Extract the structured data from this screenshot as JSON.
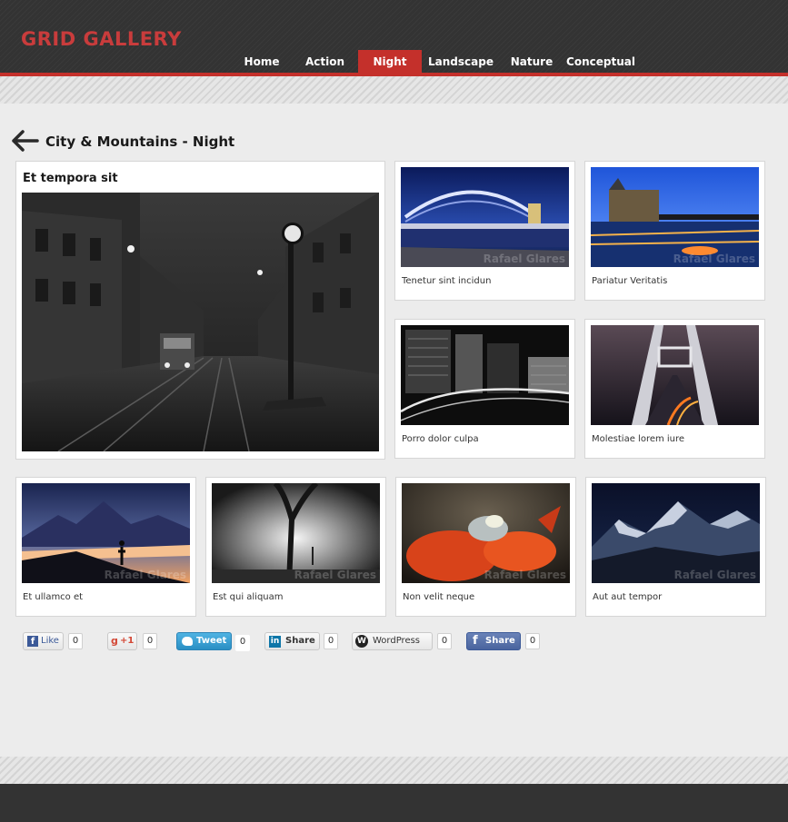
{
  "header": {
    "logo": "GRID GALLERY",
    "nav": [
      {
        "label": "Home",
        "active": false
      },
      {
        "label": "Action",
        "active": false
      },
      {
        "label": "Night",
        "active": true
      },
      {
        "label": "Landscape",
        "active": false
      },
      {
        "label": "Nature",
        "active": false
      },
      {
        "label": "Conceptual",
        "active": false
      }
    ]
  },
  "page": {
    "title": "City & Mountains - Night",
    "back_icon": "arrow-left-icon"
  },
  "feature": {
    "title": "Et tempora sit"
  },
  "gallery": [
    {
      "caption": "Tenetur sint incidun",
      "watermark": "Rafael Glares"
    },
    {
      "caption": "Pariatur Veritatis",
      "watermark": "Rafael Glares"
    },
    {
      "caption": "Porro dolor culpa",
      "watermark": ""
    },
    {
      "caption": "Molestiae lorem iure",
      "watermark": ""
    },
    {
      "caption": "Et ullamco et",
      "watermark": "Rafael Glares"
    },
    {
      "caption": "Est qui aliquam",
      "watermark": "Rafael Glares"
    },
    {
      "caption": "Non velit neque",
      "watermark": "Rafael Glares"
    },
    {
      "caption": "Aut aut tempor",
      "watermark": "Rafael Glares"
    }
  ],
  "social": {
    "facebook_like": {
      "label": "Like",
      "count": "0"
    },
    "google_plus": {
      "label": "+1",
      "count": "0"
    },
    "twitter": {
      "label": "Tweet",
      "count": "0"
    },
    "linkedin": {
      "label": "Share",
      "count": "0"
    },
    "wordpress": {
      "label": "WordPress",
      "count": "0"
    },
    "facebook_share": {
      "label": "Share",
      "count": "0"
    }
  },
  "colors": {
    "accent": "#c4302b",
    "logo": "#c93c3c",
    "header_bg": "#333333",
    "page_bg": "#ececec"
  }
}
